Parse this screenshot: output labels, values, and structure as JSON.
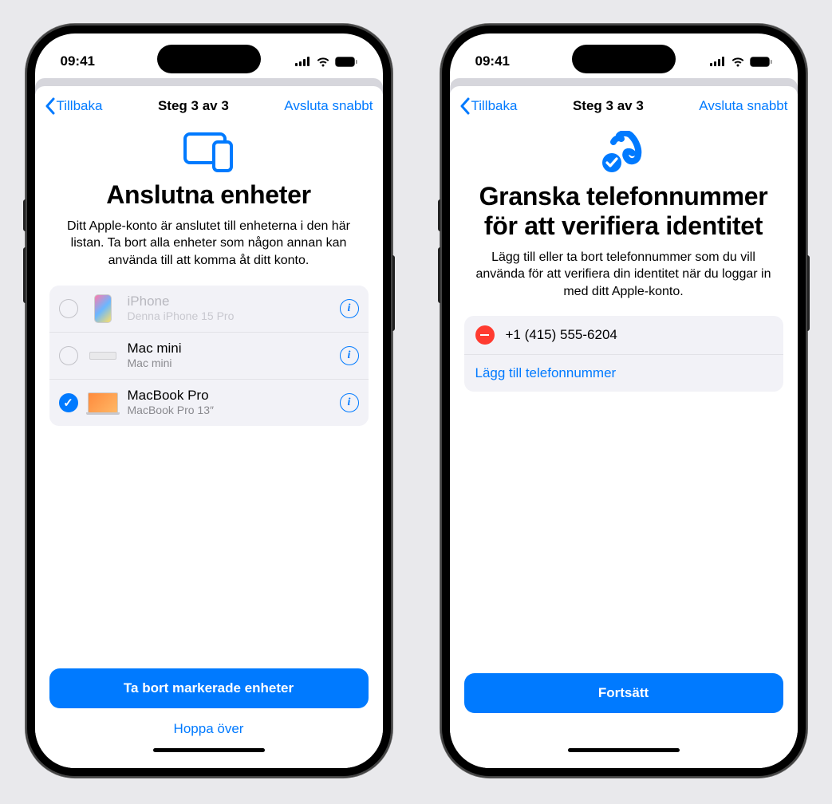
{
  "status": {
    "time": "09:41"
  },
  "nav": {
    "back": "Tillbaka",
    "step": "Steg 3 av 3",
    "quit": "Avsluta snabbt"
  },
  "left": {
    "title": "Anslutna enheter",
    "desc": "Ditt Apple-konto är anslutet till enheterna i den här listan. Ta bort alla enheter som någon annan kan använda till att komma åt ditt konto.",
    "devices": [
      {
        "name": "iPhone",
        "sub": "Denna iPhone 15 Pro",
        "checked": false,
        "disabled": true,
        "icon": "iphone"
      },
      {
        "name": "Mac mini",
        "sub": "Mac mini",
        "checked": false,
        "disabled": false,
        "icon": "macmini"
      },
      {
        "name": "MacBook Pro",
        "sub": "MacBook Pro 13″",
        "checked": true,
        "disabled": false,
        "icon": "mbp"
      }
    ],
    "primary": "Ta bort markerade enheter",
    "skip": "Hoppa över"
  },
  "right": {
    "title": "Granska telefonnummer för att verifiera identitet",
    "desc": "Lägg till eller ta bort telefonnummer som du vill använda för att verifiera din identitet när du loggar in med ditt Apple-konto.",
    "phone": "+1 (415) 555-6204",
    "add": "Lägg till telefonnummer",
    "primary": "Fortsätt"
  }
}
